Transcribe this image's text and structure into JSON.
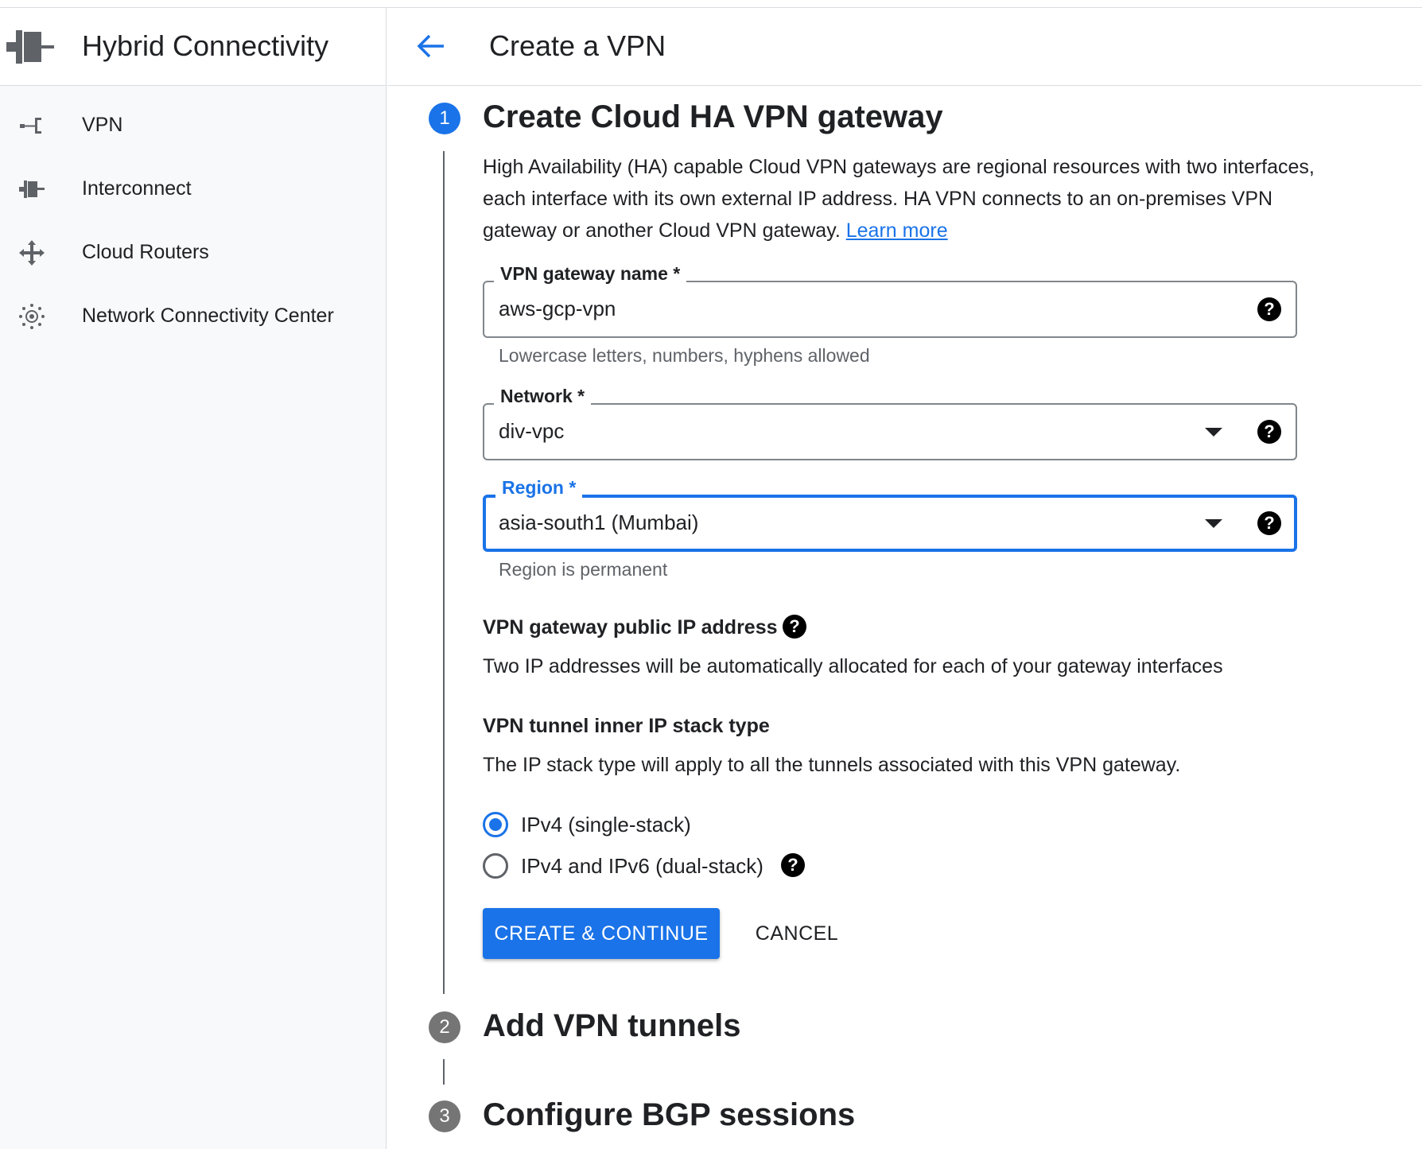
{
  "sidebar": {
    "product_title": "Hybrid Connectivity",
    "items": [
      {
        "label": "VPN",
        "icon": "vpn-icon"
      },
      {
        "label": "Interconnect",
        "icon": "interconnect-icon"
      },
      {
        "label": "Cloud Routers",
        "icon": "cloud-routers-icon"
      },
      {
        "label": "Network Connectivity Center",
        "icon": "network-connectivity-center-icon"
      }
    ]
  },
  "header": {
    "title": "Create a VPN"
  },
  "steps": [
    {
      "number": "1",
      "title": "Create Cloud HA VPN gateway",
      "state": "active"
    },
    {
      "number": "2",
      "title": "Add VPN tunnels",
      "state": "inactive"
    },
    {
      "number": "3",
      "title": "Configure BGP sessions",
      "state": "inactive"
    }
  ],
  "step1": {
    "description": "High Availability (HA) capable Cloud VPN gateways are regional resources with two interfaces, each interface with its own external IP address. HA VPN connects to an on-premises VPN gateway or another Cloud VPN gateway.",
    "learn_more": "Learn more",
    "gateway_name": {
      "label": "VPN gateway name *",
      "value": "aws-gcp-vpn",
      "hint": "Lowercase letters, numbers, hyphens allowed"
    },
    "network": {
      "label": "Network *",
      "value": "div-vpc"
    },
    "region": {
      "label": "Region *",
      "value": "asia-south1 (Mumbai)",
      "hint": "Region is permanent"
    },
    "public_ip": {
      "heading": "VPN gateway public IP address",
      "text": "Two IP addresses will be automatically allocated for each of your gateway interfaces"
    },
    "stack_type": {
      "heading": "VPN tunnel inner IP stack type",
      "text": "The IP stack type will apply to all the tunnels associated with this VPN gateway.",
      "options": [
        {
          "label": "IPv4 (single-stack)",
          "checked": true
        },
        {
          "label": "IPv4 and IPv6 (dual-stack)",
          "checked": false
        }
      ]
    },
    "create_button": "CREATE & CONTINUE",
    "cancel_button": "CANCEL"
  },
  "colors": {
    "accent": "#1a73e8",
    "inactive_step": "#757575",
    "sidebar_bg": "#f8f9fa"
  },
  "help_glyph": "?"
}
